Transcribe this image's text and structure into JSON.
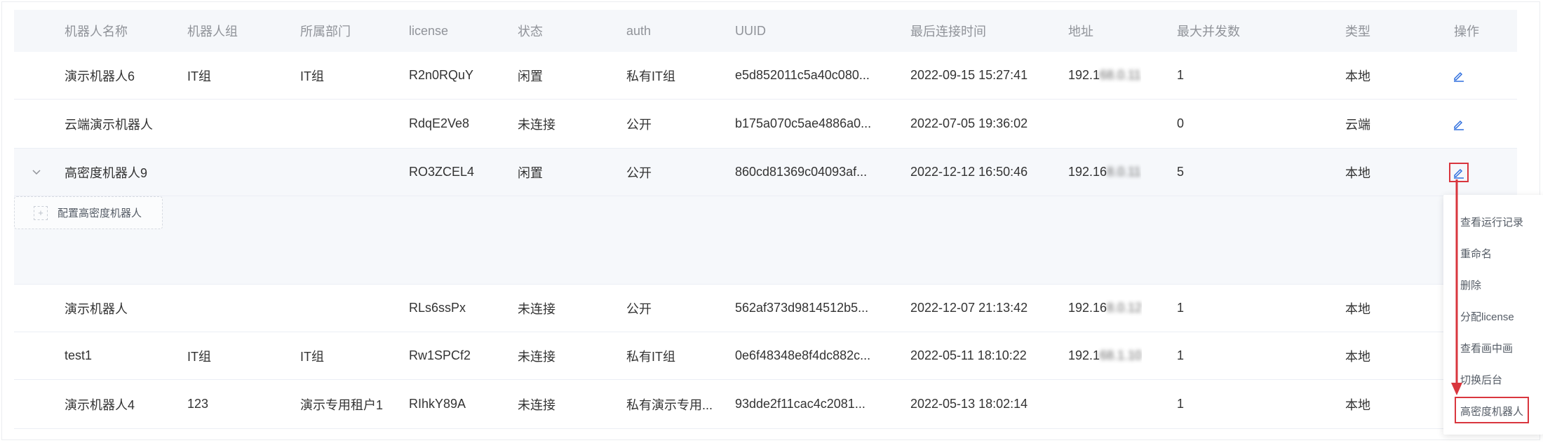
{
  "table": {
    "columns": [
      "机器人名称",
      "机器人组",
      "所属部门",
      "license",
      "状态",
      "auth",
      "UUID",
      "最后连接时间",
      "地址",
      "最大并发数",
      "类型",
      "操作"
    ],
    "rows": [
      {
        "name": "演示机器人6",
        "group": "IT组",
        "dept": "IT组",
        "license": "R2n0RQuY",
        "status": "闲置",
        "auth": "私有IT组",
        "uuid": "e5d852011c5a40c080...",
        "last_conn": "2022-09-15 15:27:41",
        "address": "192.1",
        "address_blur": "68.0.11",
        "max": "1",
        "type": "本地"
      },
      {
        "name": "云端演示机器人",
        "group": "",
        "dept": "",
        "license": "RdqE2Ve8",
        "status": "未连接",
        "auth": "公开",
        "uuid": "b175a070c5ae4886a0...",
        "last_conn": "2022-07-05 19:36:02",
        "address": "",
        "address_blur": "",
        "max": "0",
        "type": "云端"
      },
      {
        "name": "高密度机器人9",
        "group": "",
        "dept": "",
        "license": "RO3ZCEL4",
        "status": "闲置",
        "auth": "公开",
        "uuid": "860cd81369c04093af...",
        "last_conn": "2022-12-12 16:50:46",
        "address": "192.16",
        "address_blur": "8.0.11",
        "max": "5",
        "type": "本地"
      },
      {
        "name": "演示机器人",
        "group": "",
        "dept": "",
        "license": "RLs6ssPx",
        "status": "未连接",
        "auth": "公开",
        "uuid": "562af373d9814512b5...",
        "last_conn": "2022-12-07 21:13:42",
        "address": "192.16",
        "address_blur": "8.0.12",
        "max": "1",
        "type": "本地"
      },
      {
        "name": "test1",
        "group": "IT组",
        "dept": "IT组",
        "license": "Rw1SPCf2",
        "status": "未连接",
        "auth": "私有IT组",
        "uuid": "0e6f48348e8f4dc882c...",
        "last_conn": "2022-05-11 18:10:22",
        "address": "192.1",
        "address_blur": "68.1.10",
        "max": "1",
        "type": "本地"
      },
      {
        "name": "演示机器人4",
        "group": "123",
        "dept": "演示专用租户1",
        "license": "RIhkY89A",
        "status": "未连接",
        "auth": "私有演示专用...",
        "uuid": "93dde2f11cac4c2081...",
        "last_conn": "2022-05-13 18:02:14",
        "address": "",
        "address_blur": "",
        "max": "1",
        "type": "本地"
      }
    ]
  },
  "expanded": {
    "config_label": "配置高密度机器人"
  },
  "menu": {
    "items": [
      "查看运行记录",
      "重命名",
      "删除",
      "分配license",
      "查看画中画",
      "切换后台",
      "高密度机器人"
    ]
  },
  "colors": {
    "header_bg": "#f5f7fa",
    "expanded_bg": "#f6f8fb",
    "highlight": "#d9363e",
    "edit_icon": "#2f6fde"
  },
  "icons": {
    "edit": "edit-icon",
    "expand": "chevron-down-icon",
    "add": "plus-icon"
  }
}
